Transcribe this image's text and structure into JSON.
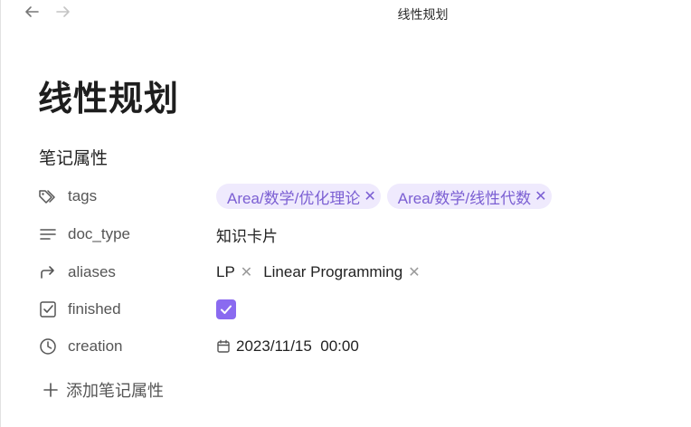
{
  "tab": {
    "title": "线性规划"
  },
  "page": {
    "title": "线性规划"
  },
  "properties": {
    "heading": "笔记属性",
    "tags": {
      "name": "tags",
      "values": [
        "Area/数学/优化理论",
        "Area/数学/线性代数"
      ]
    },
    "doc_type": {
      "name": "doc_type",
      "value": "知识卡片"
    },
    "aliases": {
      "name": "aliases",
      "values": [
        "LP",
        "Linear Programming"
      ]
    },
    "finished": {
      "name": "finished",
      "checked": true
    },
    "creation": {
      "name": "creation",
      "value": "2023/11/15  00:00"
    },
    "add_label": "添加笔记属性"
  },
  "icons": {
    "back": "arrow-left-icon",
    "forward": "arrow-right-icon",
    "tags": "tags-icon",
    "doc_type": "text-lines-icon",
    "aliases": "forward-arrow-icon",
    "finished": "checkbox-icon",
    "creation": "clock-icon",
    "date": "calendar-icon",
    "add": "plus-icon"
  },
  "colors": {
    "accent": "#8a6af0",
    "tag_bg": "#efeafd",
    "tag_text": "#7b5fd3"
  }
}
